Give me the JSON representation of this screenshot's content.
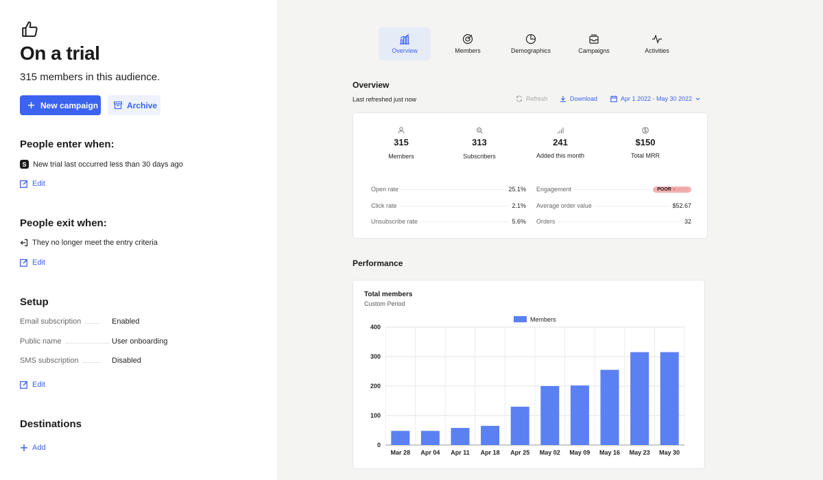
{
  "audience": {
    "title": "On a trial",
    "subtitle": "315 members in this audience."
  },
  "actions": {
    "new_campaign": "New campaign",
    "archive": "Archive"
  },
  "enter": {
    "heading": "People enter when:",
    "badge": "S",
    "rule": "New trial last occurred less than 30 days ago",
    "edit": "Edit"
  },
  "exit": {
    "heading": "People exit when:",
    "rule": "They no longer meet the entry criteria",
    "edit": "Edit"
  },
  "setup": {
    "heading": "Setup",
    "rows": [
      {
        "key": "Email subscription",
        "value": "Enabled"
      },
      {
        "key": "Public name",
        "value": "User onboarding"
      },
      {
        "key": "SMS subscription",
        "value": "Disabled"
      }
    ],
    "edit": "Edit"
  },
  "destinations": {
    "heading": "Destinations",
    "add": "Add"
  },
  "tabs": [
    {
      "label": "Overview",
      "icon": "bar-chart-icon",
      "active": true
    },
    {
      "label": "Members",
      "icon": "target-icon",
      "active": false
    },
    {
      "label": "Demographics",
      "icon": "pie-chart-icon",
      "active": false
    },
    {
      "label": "Campaigns",
      "icon": "inbox-icon",
      "active": false
    },
    {
      "label": "Activities",
      "icon": "pulse-icon",
      "active": false
    }
  ],
  "overview": {
    "title": "Overview",
    "last_refreshed": "Last refreshed just now",
    "refresh": "Refresh",
    "download": "Download",
    "date_range": "Apr 1 2022 - May 30 2022",
    "stats": [
      {
        "icon": "user-icon",
        "value": "315",
        "label": "Members"
      },
      {
        "icon": "subscriber-icon",
        "value": "313",
        "label": "Subscribers"
      },
      {
        "icon": "signal-icon",
        "value": "241",
        "label": "Added this month"
      },
      {
        "icon": "dollar-icon",
        "value": "$150",
        "label": "Total MRR"
      }
    ],
    "metrics_left": [
      {
        "key": "Open rate",
        "value": "25.1%"
      },
      {
        "key": "Click rate",
        "value": "2.1%"
      },
      {
        "key": "Unsubscribe rate",
        "value": "5.6%"
      }
    ],
    "metrics_right": [
      {
        "key": "Engagement",
        "value": "POOR"
      },
      {
        "key": "Average order value",
        "value": "$52.67"
      },
      {
        "key": "Orders",
        "value": "32"
      }
    ]
  },
  "performance": {
    "title": "Performance",
    "chart_title": "Total members",
    "chart_subtitle": "Custom Period"
  },
  "colors": {
    "accent": "#3b63f0",
    "bar": "#5a80f2",
    "poor_badge": "#f2b0b0"
  },
  "chart_data": {
    "type": "bar",
    "categories": [
      "Mar 28",
      "Apr 04",
      "Apr 11",
      "Apr 18",
      "Apr 25",
      "May 02",
      "May 09",
      "May 16",
      "May 23",
      "May 30"
    ],
    "series": [
      {
        "name": "Members",
        "values": [
          48,
          48,
          58,
          65,
          130,
          200,
          202,
          255,
          315,
          315
        ]
      }
    ],
    "ylim": [
      0,
      400
    ],
    "yticks": [
      0,
      100,
      200,
      300,
      400
    ],
    "grid": true,
    "legend": "top-center"
  }
}
